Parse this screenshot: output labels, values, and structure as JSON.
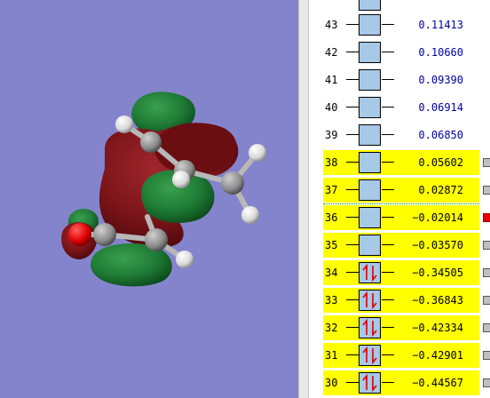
{
  "viewer": {
    "label": "molecular-orbital-isosurface-view"
  },
  "orbitals": [
    {
      "index": "43",
      "energy": "0.11413",
      "occupied": false,
      "highlight": false,
      "selector": false
    },
    {
      "index": "42",
      "energy": "0.10660",
      "occupied": false,
      "highlight": false,
      "selector": false
    },
    {
      "index": "41",
      "energy": "0.09390",
      "occupied": false,
      "highlight": false,
      "selector": false
    },
    {
      "index": "40",
      "energy": "0.06914",
      "occupied": false,
      "highlight": false,
      "selector": false
    },
    {
      "index": "39",
      "energy": "0.06850",
      "occupied": false,
      "highlight": false,
      "selector": false
    },
    {
      "index": "38",
      "energy": "0.05602",
      "occupied": false,
      "highlight": true,
      "selector": true,
      "selected": false
    },
    {
      "index": "37",
      "energy": "0.02872",
      "occupied": false,
      "highlight": true,
      "selector": true,
      "selected": false
    },
    {
      "index": "36",
      "energy": "−0.02014",
      "occupied": false,
      "highlight": true,
      "selector": true,
      "selected": true
    },
    {
      "index": "35",
      "energy": "−0.03570",
      "occupied": false,
      "highlight": true,
      "selector": true,
      "selected": false
    },
    {
      "index": "34",
      "energy": "−0.34505",
      "occupied": true,
      "highlight": true,
      "selector": true,
      "selected": false
    },
    {
      "index": "33",
      "energy": "−0.36843",
      "occupied": true,
      "highlight": true,
      "selector": true,
      "selected": false
    },
    {
      "index": "32",
      "energy": "−0.42334",
      "occupied": true,
      "highlight": true,
      "selector": true,
      "selected": false
    },
    {
      "index": "31",
      "energy": "−0.42901",
      "occupied": true,
      "highlight": true,
      "selector": true,
      "selected": false
    },
    {
      "index": "30",
      "energy": "−0.44567",
      "occupied": true,
      "highlight": true,
      "selector": true,
      "selected": false
    }
  ],
  "colors": {
    "viewer_background": "#8484cc",
    "highlight": "#ffff00",
    "orbital_box": "#a8c8e8",
    "positive_lobe": "#1e7a34",
    "negative_lobe": "#7a1418",
    "selected_marker": "#e00000",
    "virtual_energy_text": "#0000a0"
  }
}
